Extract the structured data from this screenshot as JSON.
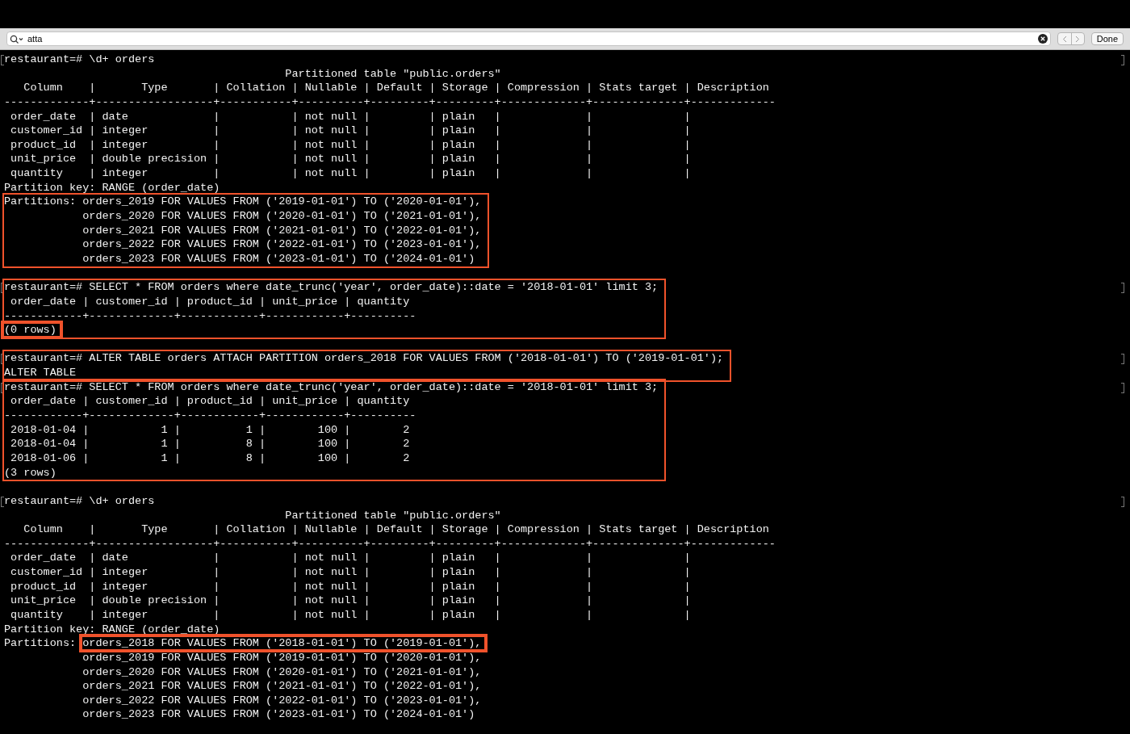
{
  "find_bar": {
    "search_field": {
      "value": "atta"
    },
    "done_label": "Done"
  },
  "terminal": {
    "blocks": [
      {
        "highlighted": false,
        "marked": true,
        "spaced": false,
        "lines": [
          {
            "text": "restaurant=# \\d+ orders"
          },
          {
            "text": "                                           Partitioned table \"public.orders\""
          },
          {
            "text": "   Column    |       Type       | Collation | Nullable | Default | Storage | Compression | Stats target | Description"
          },
          {
            "text": "-------------+------------------+-----------+----------+---------+---------+-------------+--------------+-------------"
          },
          {
            "text": " order_date  | date             |           | not null |         | plain   |             |              |"
          },
          {
            "text": " customer_id | integer          |           | not null |         | plain   |             |              |"
          },
          {
            "text": " product_id  | integer          |           | not null |         | plain   |             |              |"
          },
          {
            "text": " unit_price  | double precision |           | not null |         | plain   |             |              |"
          },
          {
            "text": " quantity    | integer          |           | not null |         | plain   |             |              |"
          },
          {
            "text": "Partition key: RANGE (order_date)"
          }
        ]
      },
      {
        "highlighted": true,
        "marked": false,
        "spaced": false,
        "lines": [
          {
            "text": "Partitions: orders_2019 FOR VALUES FROM ('2019-01-01') TO ('2020-01-01'),"
          },
          {
            "text": "            orders_2020 FOR VALUES FROM ('2020-01-01') TO ('2021-01-01'),"
          },
          {
            "text": "            orders_2021 FOR VALUES FROM ('2021-01-01') TO ('2022-01-01'),"
          },
          {
            "text": "            orders_2022 FOR VALUES FROM ('2022-01-01') TO ('2023-01-01'),"
          },
          {
            "text": "            orders_2023 FOR VALUES FROM ('2023-01-01') TO ('2024-01-01')"
          }
        ]
      },
      {
        "highlighted": true,
        "marked": true,
        "spaced": true,
        "lines": [
          {
            "text": "restaurant=# SELECT * FROM orders where date_trunc('year', order_date)::date = '2018-01-01' limit 3;"
          },
          {
            "text": " order_date | customer_id | product_id | unit_price | quantity"
          },
          {
            "text": "------------+-------------+------------+------------+----------"
          },
          {
            "segments": [
              {
                "text": "(0 rows)",
                "highlighted": true
              }
            ]
          }
        ]
      },
      {
        "highlighted": true,
        "marked": true,
        "spaced": true,
        "lines": [
          {
            "text": "restaurant=# ALTER TABLE orders ATTACH PARTITION orders_2018 FOR VALUES FROM ('2018-01-01') TO ('2019-01-01');"
          },
          {
            "text": "ALTER TABLE"
          }
        ]
      },
      {
        "highlighted": true,
        "marked": true,
        "spaced": false,
        "lines": [
          {
            "text": "restaurant=# SELECT * FROM orders where date_trunc('year', order_date)::date = '2018-01-01' limit 3;"
          },
          {
            "text": " order_date | customer_id | product_id | unit_price | quantity"
          },
          {
            "text": "------------+-------------+------------+------------+----------"
          },
          {
            "text": " 2018-01-04 |           1 |          1 |        100 |        2"
          },
          {
            "text": " 2018-01-04 |           1 |          8 |        100 |        2"
          },
          {
            "text": " 2018-01-06 |           1 |          8 |        100 |        2"
          },
          {
            "text": "(3 rows)"
          }
        ]
      },
      {
        "highlighted": false,
        "marked": true,
        "spaced": true,
        "lines": [
          {
            "text": "restaurant=# \\d+ orders"
          },
          {
            "text": "                                           Partitioned table \"public.orders\""
          },
          {
            "text": "   Column    |       Type       | Collation | Nullable | Default | Storage | Compression | Stats target | Description"
          },
          {
            "text": "-------------+------------------+-----------+----------+---------+---------+-------------+--------------+-------------"
          },
          {
            "text": " order_date  | date             |           | not null |         | plain   |             |              |"
          },
          {
            "text": " customer_id | integer          |           | not null |         | plain   |             |              |"
          },
          {
            "text": " product_id  | integer          |           | not null |         | plain   |             |              |"
          },
          {
            "text": " unit_price  | double precision |           | not null |         | plain   |             |              |"
          },
          {
            "text": " quantity    | integer          |           | not null |         | plain   |             |              |"
          },
          {
            "text": "Partition key: RANGE (order_date)"
          },
          {
            "segments": [
              {
                "text": "Partitions: ",
                "highlighted": false
              },
              {
                "text": "orders_2018 FOR VALUES FROM ('2018-01-01') TO ('2019-01-01'),",
                "highlighted": true
              }
            ]
          },
          {
            "text": "            orders_2019 FOR VALUES FROM ('2019-01-01') TO ('2020-01-01'),"
          },
          {
            "text": "            orders_2020 FOR VALUES FROM ('2020-01-01') TO ('2021-01-01'),"
          },
          {
            "text": "            orders_2021 FOR VALUES FROM ('2021-01-01') TO ('2022-01-01'),"
          },
          {
            "text": "            orders_2022 FOR VALUES FROM ('2022-01-01') TO ('2023-01-01'),"
          },
          {
            "text": "            orders_2023 FOR VALUES FROM ('2023-01-01') TO ('2024-01-01')"
          }
        ]
      }
    ]
  }
}
